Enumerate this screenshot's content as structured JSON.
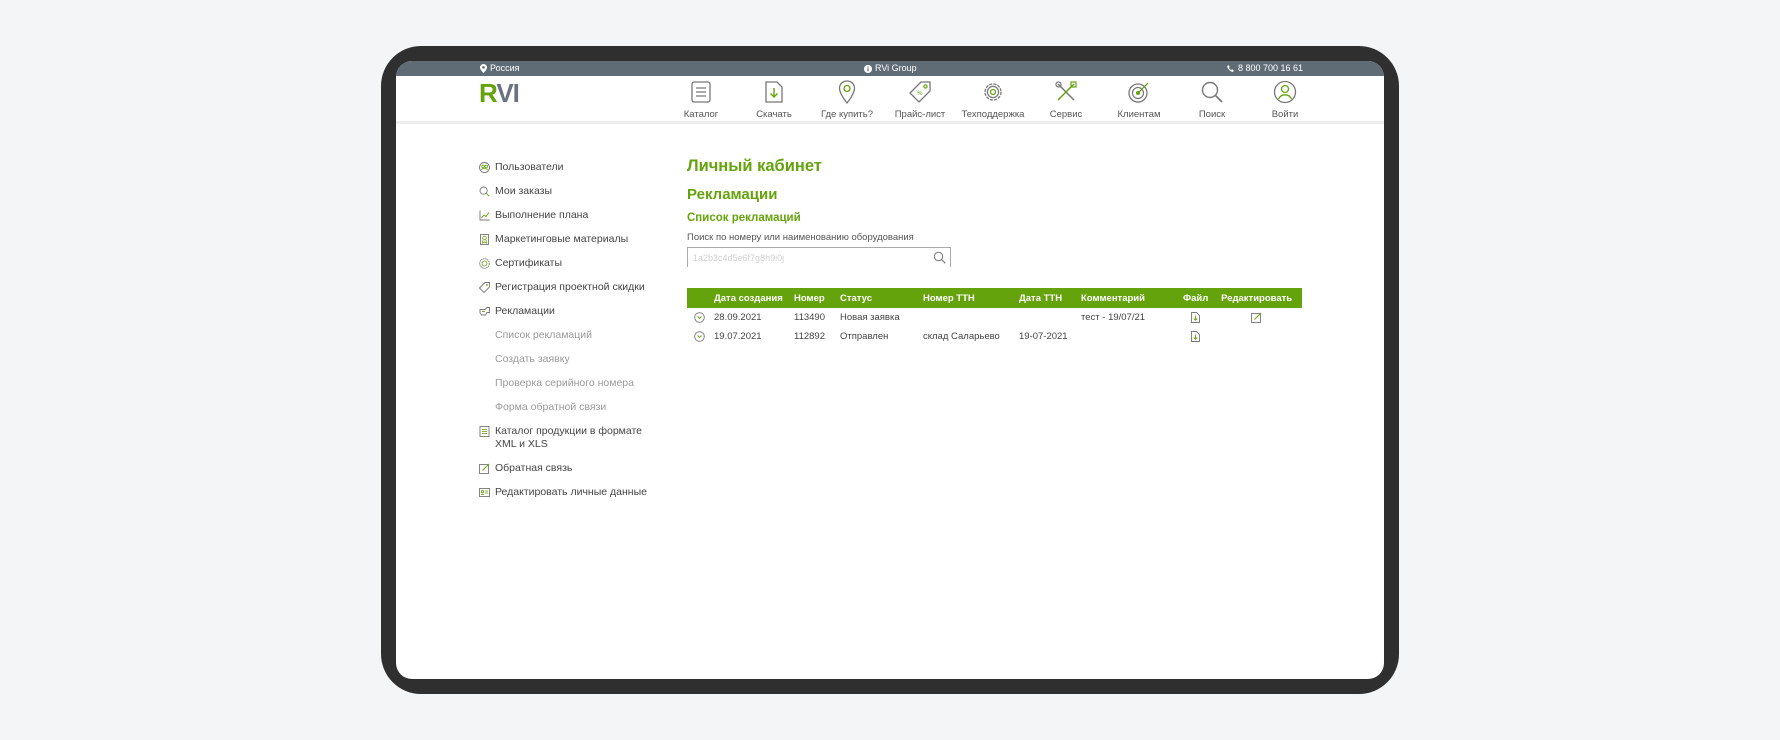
{
  "topbar": {
    "location": "Россия",
    "group": "RVi Group",
    "phone": "8 800 700 16 61"
  },
  "logo": {
    "part1": "R",
    "part2": "VI"
  },
  "nav": [
    {
      "label": "Каталог",
      "icon": "list-icon"
    },
    {
      "label": "Скачать",
      "icon": "download-icon"
    },
    {
      "label": "Где купить?",
      "icon": "map-pin-icon"
    },
    {
      "label": "Прайс-лист",
      "icon": "price-tag-icon"
    },
    {
      "label": "Техподдержка",
      "icon": "gear-icon"
    },
    {
      "label": "Сервис",
      "icon": "tools-icon"
    },
    {
      "label": "Клиентам",
      "icon": "target-icon"
    },
    {
      "label": "Поиск",
      "icon": "search-icon"
    },
    {
      "label": "Войти",
      "icon": "user-icon"
    }
  ],
  "sidebar": {
    "items": [
      {
        "label": "Пользователи",
        "icon": "users-icon"
      },
      {
        "label": "Мои заказы",
        "icon": "search-icon"
      },
      {
        "label": "Выполнение плана",
        "icon": "chart-icon"
      },
      {
        "label": "Маркетинговые материалы",
        "icon": "bookmark-icon"
      },
      {
        "label": "Сертификаты",
        "icon": "certificate-icon"
      },
      {
        "label": "Регистрация проектной скидки",
        "icon": "discount-icon"
      },
      {
        "label": "Рекламации",
        "icon": "claims-icon"
      },
      {
        "label": "Каталог продукции в формате XML и XLS",
        "icon": "document-icon"
      },
      {
        "label": "Обратная связь",
        "icon": "edit-icon"
      },
      {
        "label": "Редактировать личные данные",
        "icon": "id-card-icon"
      }
    ],
    "subitems": [
      "Список рекламаций",
      "Создать заявку",
      "Проверка серийного номера",
      "Форма обратной связи"
    ]
  },
  "main": {
    "page_title": "Личный кабинет",
    "section_title": "Рекламации",
    "sub_title": "Список рекламаций",
    "search_label": "Поиск по номеру или наименованию оборудования",
    "search_placeholder": "1a2b3c4d5e6f7g8h9i0j"
  },
  "table": {
    "headers": [
      "Дата создания",
      "Номер",
      "Статус",
      "Номер ТТН",
      "Дата ТТН",
      "Комментарий",
      "Файл",
      "Редактировать"
    ],
    "rows": [
      {
        "date": "28.09.2021",
        "number": "113490",
        "status": "Новая заявка",
        "ttn": "",
        "ttn_date": "",
        "comment": "тест - 19/07/21",
        "file": "file-icon",
        "edit": "edit-icon"
      },
      {
        "date": "19.07.2021",
        "number": "112892",
        "status": "Отправлен",
        "ttn": "склад Саларьево",
        "ttn_date": "19-07-2021",
        "comment": "",
        "file": "file-icon",
        "edit": ""
      }
    ]
  },
  "colors": {
    "accent": "#65a30d",
    "topbar": "#5f6b75",
    "frame": "#2f2f2f",
    "background": "#f4f5f7"
  }
}
